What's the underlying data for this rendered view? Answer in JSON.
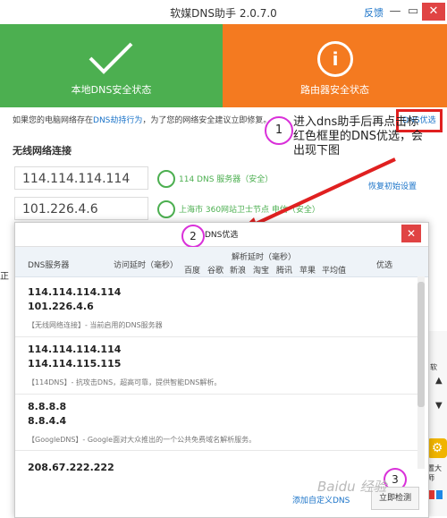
{
  "window": {
    "title": "软媒DNS助手 2.0.7.0",
    "feedback": "反馈",
    "minimize": "—",
    "restore": "▭",
    "close": "✕"
  },
  "status_panels": {
    "local": {
      "label": "本地DNS安全状态",
      "color": "#4caf50",
      "icon": "checkmark-icon"
    },
    "router": {
      "label": "路由器安全状态",
      "icon_text": "i",
      "color": "#f47a20"
    }
  },
  "warning": {
    "prefix": "如果您的电脑网络存在",
    "link": "DNS劫持行为",
    "suffix": "，为了您的网络安全建议立即修复。",
    "dns_opt_button": "DNS优选"
  },
  "annotations": {
    "step1": "1",
    "step1_text": "进入dns助手后再点击标红色框里的DNS优选，会出现下图",
    "step2": "2",
    "step3": "3"
  },
  "connection": {
    "title": "无线网络连接",
    "primary_dns": "114.114.114.114",
    "primary_status": "114 DNS 服务器（安全）",
    "secondary_dns": "101.226.4.6",
    "secondary_status": "上海市 360网站卫士节点 电信（安全）",
    "restore_link": "恢复初始设置"
  },
  "background_fragment": "正",
  "dialog": {
    "title": "DNS优选",
    "close": "✕",
    "columns": {
      "server": "DNS服务器",
      "latency": "访问延时（毫秒）",
      "resolve": "解析延时（毫秒）",
      "baidu": "百度",
      "google": "谷歌",
      "sina": "新浪",
      "taobao": "淘宝",
      "tencent": "腾讯",
      "apple": "苹果",
      "average": "平均值",
      "preferred": "优选"
    },
    "entries": [
      {
        "ip1": "114.114.114.114",
        "ip2": "101.226.4.6",
        "desc": "【无线网络连接】- 当前启用的DNS服务器"
      },
      {
        "ip1": "114.114.114.114",
        "ip2": "114.114.115.115",
        "desc": "【114DNS】- 抗攻击DNS，超高可靠，提供智能DNS解析。"
      },
      {
        "ip1": "8.8.8.8",
        "ip2": "8.8.4.4",
        "desc": "【GoogleDNS】- Google面对大众推出的一个公共免费域名解析服务。"
      },
      {
        "ip1": "208.67.222.222",
        "ip2": "",
        "desc": ""
      }
    ],
    "add_custom": "添加自定义DNS",
    "test_button": "立即检测"
  },
  "side": {
    "label": "软",
    "up": "▲",
    "down": "▼",
    "gear": "⚙",
    "master": "置大师"
  },
  "watermark": "Baidu 经验"
}
